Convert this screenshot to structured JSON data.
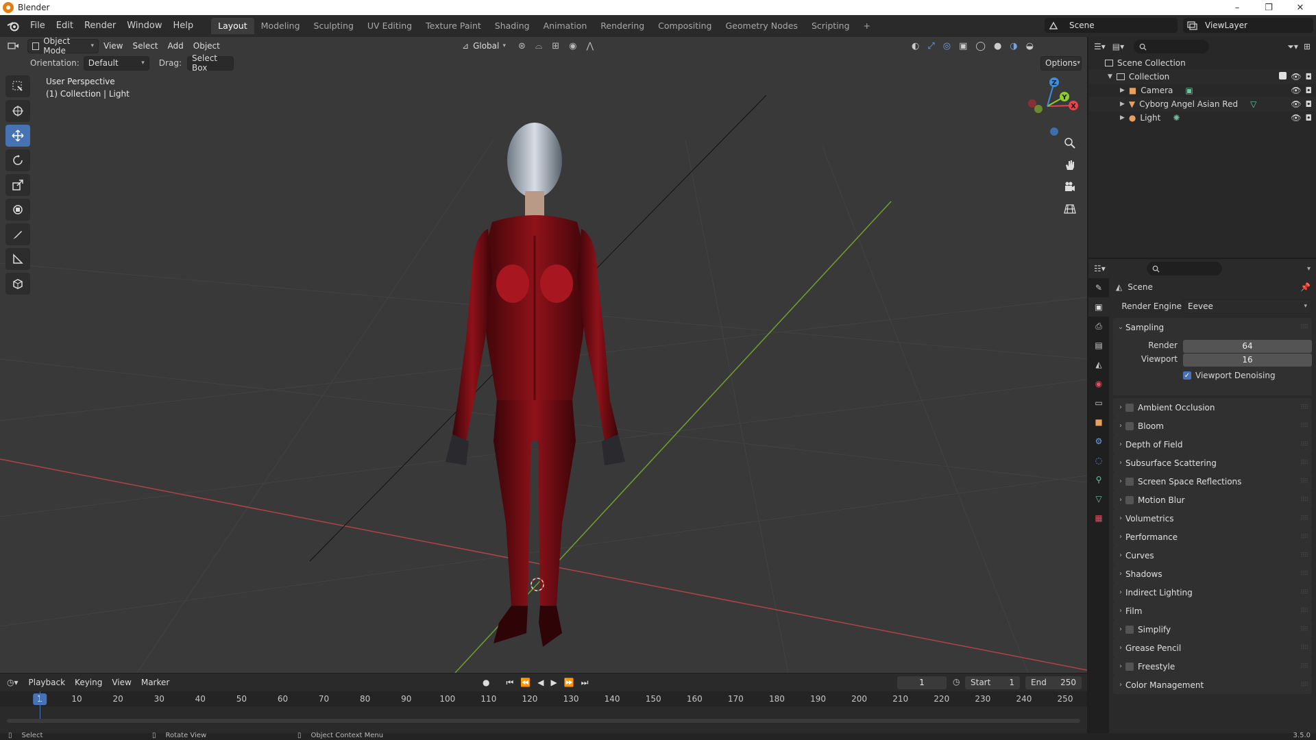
{
  "window": {
    "title": "Blender",
    "controls": [
      "–",
      "❐",
      "✕"
    ]
  },
  "menu": [
    "File",
    "Edit",
    "Render",
    "Window",
    "Help"
  ],
  "workspaces": [
    "Layout",
    "Modeling",
    "Sculpting",
    "UV Editing",
    "Texture Paint",
    "Shading",
    "Animation",
    "Rendering",
    "Compositing",
    "Geometry Nodes",
    "Scripting",
    "+"
  ],
  "scene_name": "Scene",
  "view_layer": "ViewLayer",
  "viewport": {
    "mode": "Object Mode",
    "menus": [
      "View",
      "Select",
      "Add",
      "Object"
    ],
    "transform_orientation": "Global",
    "orientation_label": "Orientation:",
    "orientation_value": "Default",
    "drag_label": "Drag:",
    "drag_value": "Select Box",
    "options": "Options",
    "view_name": "User Perspective",
    "context": "(1) Collection | Light",
    "gizmo": {
      "x": "X",
      "y": "Y",
      "z": "Z"
    }
  },
  "outliner": {
    "scene_collection": "Scene Collection",
    "collection": "Collection",
    "items": [
      "Camera",
      "Cyborg Angel Asian Red",
      "Light"
    ]
  },
  "properties": {
    "scene_label": "Scene",
    "render_engine_label": "Render Engine",
    "render_engine": "Eevee",
    "sampling": "Sampling",
    "render_label": "Render",
    "render_value": "64",
    "viewport_label": "Viewport",
    "viewport_value": "16",
    "viewport_denoising": "Viewport Denoising",
    "sections": [
      {
        "label": "Ambient Occlusion",
        "checkbox": true
      },
      {
        "label": "Bloom",
        "checkbox": true
      },
      {
        "label": "Depth of Field",
        "checkbox": false
      },
      {
        "label": "Subsurface Scattering",
        "checkbox": false
      },
      {
        "label": "Screen Space Reflections",
        "checkbox": true
      },
      {
        "label": "Motion Blur",
        "checkbox": true
      },
      {
        "label": "Volumetrics",
        "checkbox": false
      },
      {
        "label": "Performance",
        "checkbox": false
      },
      {
        "label": "Curves",
        "checkbox": false
      },
      {
        "label": "Shadows",
        "checkbox": false
      },
      {
        "label": "Indirect Lighting",
        "checkbox": false
      },
      {
        "label": "Film",
        "checkbox": false
      },
      {
        "label": "Simplify",
        "checkbox": true
      },
      {
        "label": "Grease Pencil",
        "checkbox": false
      },
      {
        "label": "Freestyle",
        "checkbox": true
      },
      {
        "label": "Color Management",
        "checkbox": false
      }
    ]
  },
  "timeline": {
    "menus": [
      "Playback",
      "Keying",
      "View",
      "Marker"
    ],
    "current_frame": "1",
    "start_label": "Start",
    "start": "1",
    "end_label": "End",
    "end": "250",
    "ticks": [
      "1",
      "10",
      "20",
      "30",
      "40",
      "50",
      "60",
      "70",
      "80",
      "90",
      "100",
      "110",
      "120",
      "130",
      "140",
      "150",
      "160",
      "170",
      "180",
      "190",
      "200",
      "210",
      "220",
      "230",
      "240",
      "250"
    ]
  },
  "statusbar": {
    "select": "Select",
    "rotate": "Rotate View",
    "context_menu": "Object Context Menu",
    "version": "3.5.0"
  },
  "colors": {
    "accent": "#4772b3",
    "x_axis": "#e8444c",
    "y_axis": "#8ccf2c",
    "z_axis": "#3d8fde",
    "viewport_bg": "#393939"
  }
}
